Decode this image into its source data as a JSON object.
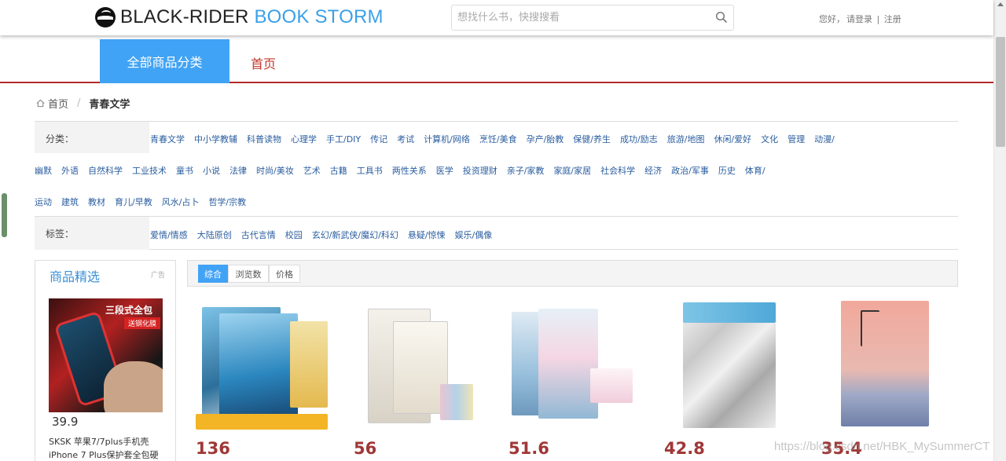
{
  "header": {
    "logo_text_main": "BLACK-RIDER",
    "logo_text_accent": "BOOK STORM",
    "search_placeholder": "想找什么书，快搜搜看",
    "greeting": "您好，",
    "login_label": "请登录",
    "divider": "|",
    "register_label": "注册"
  },
  "nav": {
    "all_categories": "全部商品分类",
    "home": "首页"
  },
  "breadcrumb": {
    "home": "首页",
    "separator": "/",
    "current": "青春文学"
  },
  "filters": {
    "category_label": "分类：",
    "category_rows": [
      [
        "青春文学",
        "中小学教辅",
        "科普读物",
        "心理学",
        "手工/DIY",
        "传记",
        "考试",
        "计算机/网络",
        "烹饪/美食",
        "孕产/胎教",
        "保健/养生",
        "成功/励志",
        "旅游/地图",
        "休闲/爱好",
        "文化",
        "管理",
        "动漫/"
      ],
      [
        "幽默",
        "外语",
        "自然科学",
        "工业技术",
        "童书",
        "小说",
        "法律",
        "时尚/美妆",
        "艺术",
        "古籍",
        "工具书",
        "两性关系",
        "医学",
        "投资理财",
        "亲子/家教",
        "家庭/家居",
        "社会科学",
        "经济",
        "政治/军事",
        "历史",
        "体育/"
      ],
      [
        "运动",
        "建筑",
        "教材",
        "育儿/早教",
        "风水/占卜",
        "哲学/宗教"
      ]
    ],
    "tag_label": "标签：",
    "tags": [
      "爱情/情感",
      "大陆原创",
      "古代言情",
      "校园",
      "玄幻/新武侠/魔幻/科幻",
      "悬疑/惊悚",
      "娱乐/偶像"
    ]
  },
  "ad": {
    "title": "商品精选",
    "tag": "广告",
    "banner_line1": "三段式全包",
    "banner_line2": "送钢化膜",
    "price": "39.9",
    "description": "SKSK 苹果7/7plus手机壳 iPhone 7 Plus保护套全包硬"
  },
  "sort": {
    "options": [
      "综合",
      "浏览数",
      "价格"
    ],
    "active_index": 0
  },
  "products": [
    {
      "price": "136"
    },
    {
      "price": "56"
    },
    {
      "price": "51.6"
    },
    {
      "price": "42.8"
    },
    {
      "price": "35.4"
    }
  ],
  "watermark": "https://blog.csdn.net/HBK_MySummerCT",
  "colors": {
    "accent_blue": "#41a3f5",
    "nav_underline": "#b22a2a",
    "price_red": "#a03737",
    "link_blue": "#2a5d9f"
  }
}
